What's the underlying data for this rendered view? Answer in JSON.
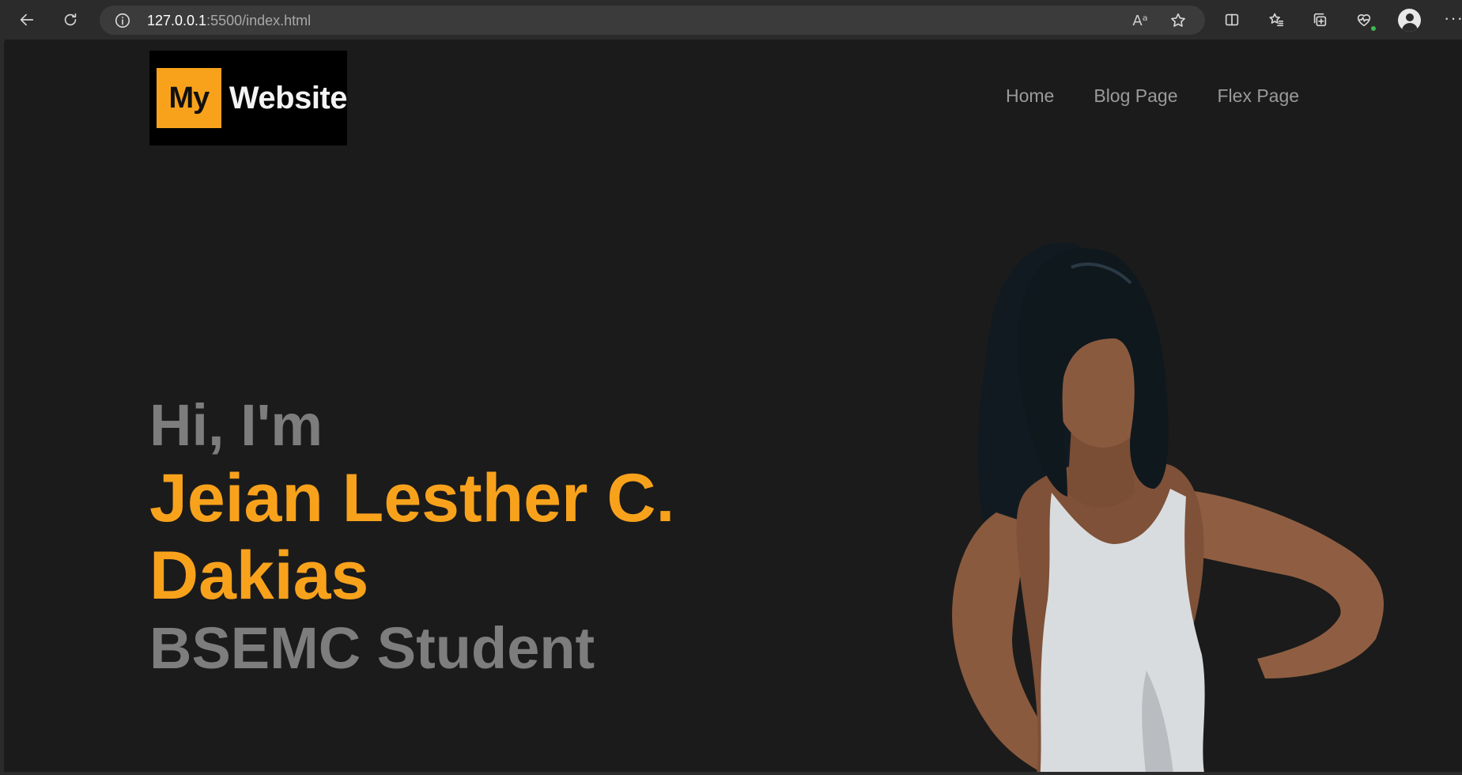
{
  "browser": {
    "url_host": "127.0.0.1",
    "url_rest": ":5500/index.html",
    "icons": [
      "back-icon",
      "refresh-icon",
      "site-info-icon",
      "read-aloud-icon",
      "favorite-star-icon",
      "split-screen-icon",
      "favorites-icon",
      "collections-icon",
      "browser-essentials-icon",
      "profile-icon",
      "more-options-icon"
    ],
    "read_aloud_glyph": "Aᵃ",
    "more_glyph": "···"
  },
  "site": {
    "logo": {
      "part1": "My",
      "part2": "Website",
      "accent": "#f8a21c"
    },
    "nav": [
      {
        "label": "Home"
      },
      {
        "label": "Blog Page"
      },
      {
        "label": "Flex Page"
      }
    ],
    "hero": {
      "greeting": "Hi, I'm",
      "name": "Jeian Lesther C. Dakias",
      "role": "BSEMC Student",
      "accent_color": "#f8a21c",
      "muted_color": "#7d7d7d",
      "background": "#1b1b1b"
    }
  }
}
